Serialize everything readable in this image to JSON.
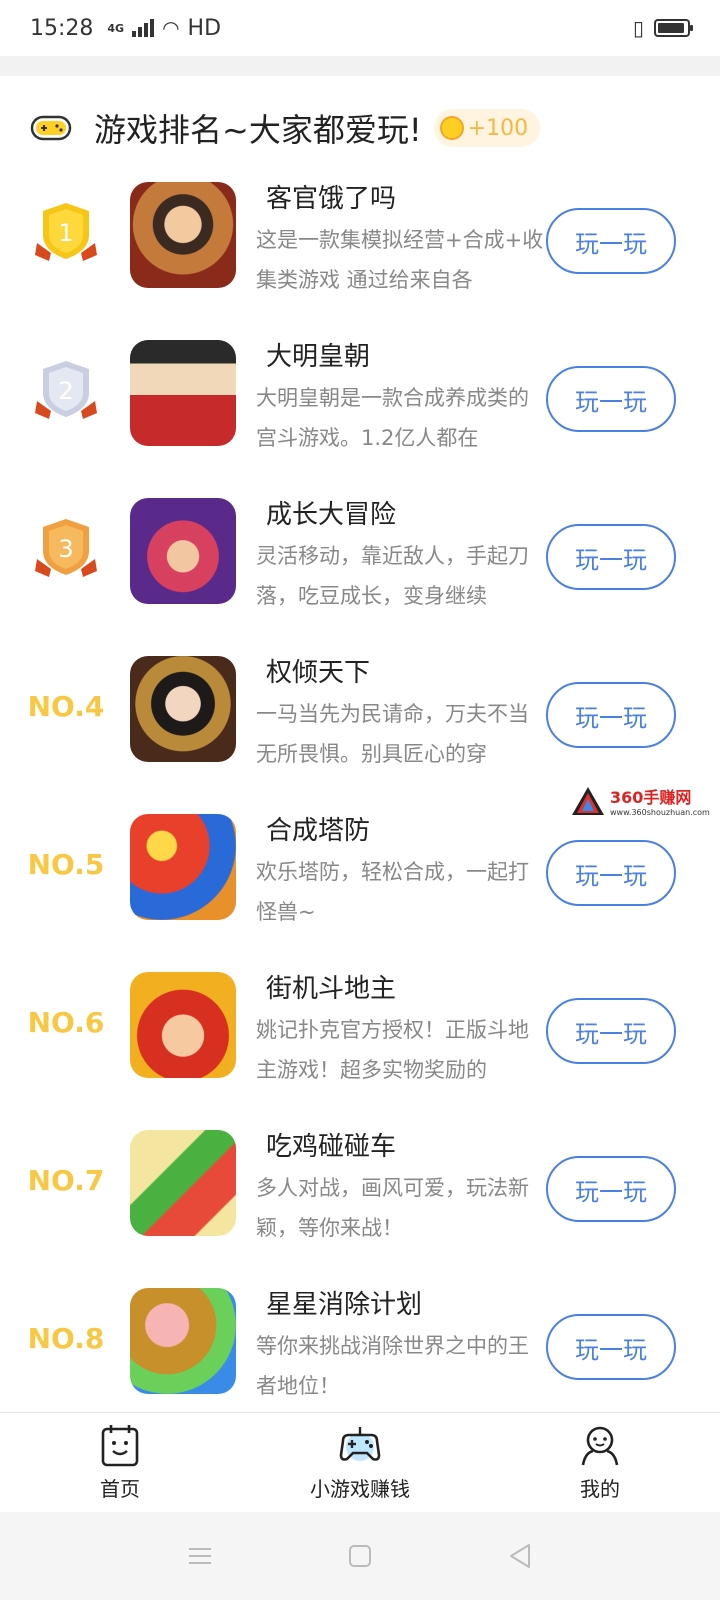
{
  "status_bar": {
    "time": "15:28",
    "network": "4G",
    "hd": "HD"
  },
  "header": {
    "title": "游戏排名~大家都爱玩!",
    "coin_bonus": "+100"
  },
  "games": [
    {
      "rank": "1",
      "name": "客官饿了吗",
      "desc": "这是一款集模拟经营+合成+收集类游戏 通过给来自各",
      "button": "玩一玩"
    },
    {
      "rank": "2",
      "name": "大明皇朝",
      "desc": "大明皇朝是一款合成养成类的宫斗游戏。1.2亿人都在",
      "button": "玩一玩"
    },
    {
      "rank": "3",
      "name": "成长大冒险",
      "desc": "灵活移动，靠近敌人，手起刀落，吃豆成长，变身继续",
      "button": "玩一玩"
    },
    {
      "rank": "NO.4",
      "name": "权倾天下",
      "desc": "一马当先为民请命，万夫不当无所畏惧。别具匠心的穿",
      "button": "玩一玩"
    },
    {
      "rank": "NO.5",
      "name": "合成塔防",
      "desc": "欢乐塔防，轻松合成，一起打怪兽~",
      "button": "玩一玩"
    },
    {
      "rank": "NO.6",
      "name": "街机斗地主",
      "desc": "姚记扑克官方授权！正版斗地主游戏！超多实物奖励的",
      "button": "玩一玩"
    },
    {
      "rank": "NO.7",
      "name": "吃鸡碰碰车",
      "desc": "多人对战，画风可爱，玩法新颖，等你来战！",
      "button": "玩一玩"
    },
    {
      "rank": "NO.8",
      "name": "星星消除计划",
      "desc": "等你来挑战消除世界之中的王者地位！",
      "button": "玩一玩"
    }
  ],
  "watermark": {
    "title": "360手赚网",
    "url": "www.360shouzhuan.com"
  },
  "bottom_nav": [
    {
      "label": "首页",
      "icon": "home-icon"
    },
    {
      "label": "小游戏赚钱",
      "icon": "gamepad-icon"
    },
    {
      "label": "我的",
      "icon": "profile-icon"
    }
  ],
  "colors": {
    "accent": "#4a7fe6",
    "rank_gold": "#f8c845",
    "gold_medal": "#f5c518",
    "silver_medal": "#c9cfe0",
    "bronze_medal": "#f0a040"
  }
}
